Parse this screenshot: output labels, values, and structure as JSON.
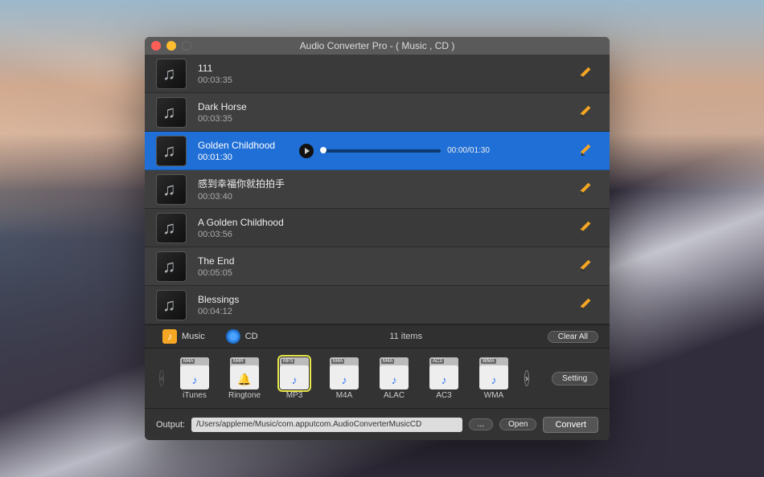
{
  "window": {
    "title": "Audio Converter Pro - ( Music , CD )"
  },
  "tracks": [
    {
      "name": "111",
      "dur": "00:03:35",
      "selected": false
    },
    {
      "name": "Dark Horse",
      "dur": "00:03:35",
      "selected": false
    },
    {
      "name": "Golden Childhood",
      "dur": "00:01:30",
      "selected": true,
      "playpos": "00:00",
      "playtotal": "01:30"
    },
    {
      "name": "感到幸福你就拍拍手",
      "dur": "00:03:40",
      "selected": false
    },
    {
      "name": "A Golden Childhood",
      "dur": "00:03:56",
      "selected": false
    },
    {
      "name": "The End",
      "dur": "00:05:05",
      "selected": false
    },
    {
      "name": "Blessings",
      "dur": "00:04:12",
      "selected": false
    }
  ],
  "tabs": {
    "music": "Music",
    "cd": "CD",
    "item_count": "11 items",
    "clear_all": "Clear All"
  },
  "formats": [
    {
      "badge": "M4A",
      "label": "iTunes",
      "glyph": "♪",
      "selected": false
    },
    {
      "badge": "M4R",
      "label": "Ringtone",
      "glyph": "🔔",
      "selected": false
    },
    {
      "badge": "MP3",
      "label": "MP3",
      "glyph": "♪",
      "selected": true
    },
    {
      "badge": "M4A",
      "label": "M4A",
      "glyph": "♪",
      "selected": false
    },
    {
      "badge": "M4A",
      "label": "ALAC",
      "glyph": "♪",
      "selected": false
    },
    {
      "badge": "AC3",
      "label": "AC3",
      "glyph": "♪",
      "selected": false
    },
    {
      "badge": "WMA",
      "label": "WMA",
      "glyph": "♪",
      "selected": false
    }
  ],
  "setting_label": "Setting",
  "output": {
    "label": "Output:",
    "path": "/Users/appleme/Music/com.apputcom.AudioConverterMusicCD",
    "browse": "...",
    "open": "Open",
    "convert": "Convert"
  }
}
